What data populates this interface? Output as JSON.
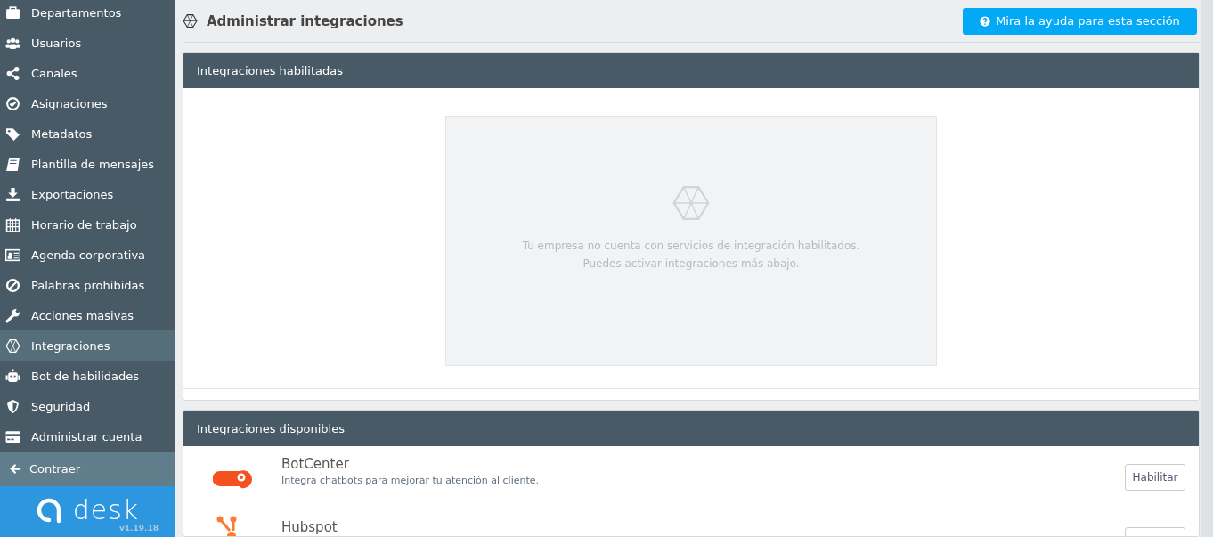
{
  "sidebar": {
    "items": [
      {
        "label": "Departamentos",
        "selected": false
      },
      {
        "label": "Usuarios",
        "selected": false
      },
      {
        "label": "Canales",
        "selected": false
      },
      {
        "label": "Asignaciones",
        "selected": false
      },
      {
        "label": "Metadatos",
        "selected": false
      },
      {
        "label": "Plantilla de mensajes",
        "selected": false
      },
      {
        "label": "Exportaciones",
        "selected": false
      },
      {
        "label": "Horario de trabajo",
        "selected": false
      },
      {
        "label": "Agenda corporativa",
        "selected": false
      },
      {
        "label": "Palabras prohibidas",
        "selected": false
      },
      {
        "label": "Acciones masivas",
        "selected": false
      },
      {
        "label": "Integraciones",
        "selected": true
      },
      {
        "label": "Bot de habilidades",
        "selected": false
      },
      {
        "label": "Seguridad",
        "selected": false
      },
      {
        "label": "Administrar cuenta",
        "selected": false
      }
    ],
    "collapse": "Contraer",
    "logo": {
      "name": "desk",
      "version": "v1.19.18"
    }
  },
  "header": {
    "title": "Administrar integraciones",
    "help_button": "Mira la ayuda para esta sección"
  },
  "enabled_panel": {
    "title": "Integraciones habilitadas",
    "empty_lines": [
      "Tu empresa no cuenta con servicios de integración habilitados.",
      "Puedes activar integraciones más abajo."
    ]
  },
  "available_panel": {
    "title": "Integraciones disponibles",
    "items": [
      {
        "kind": "bot",
        "name": "BotCenter",
        "description": "Integra chatbots para mejorar tu atención al cliente.",
        "button": "Habilitar"
      },
      {
        "kind": "hub",
        "name": "Hubspot"
      }
    ]
  }
}
